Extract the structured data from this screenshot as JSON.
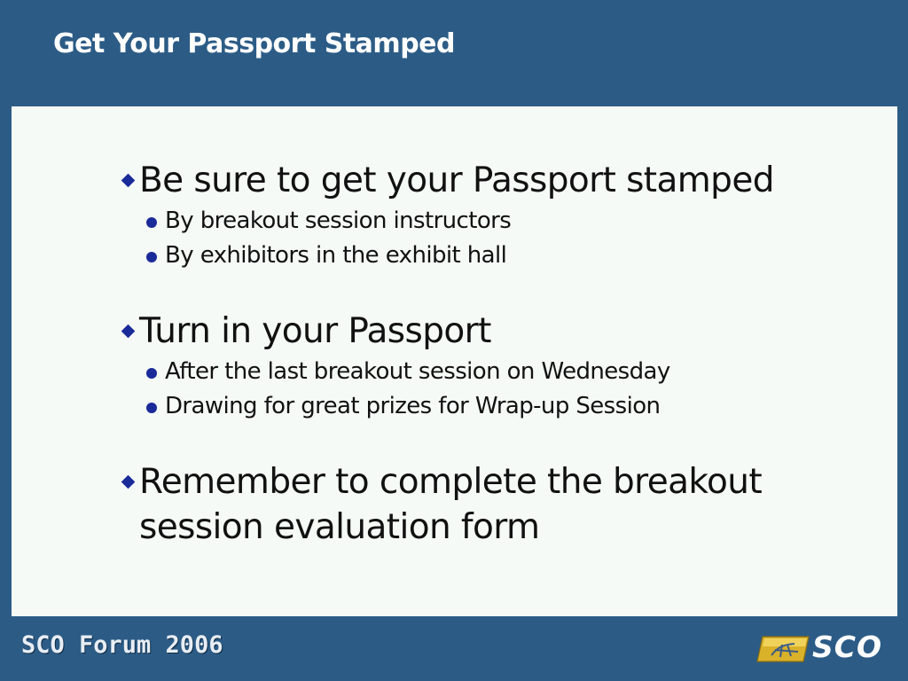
{
  "slide": {
    "title": "Get Your Passport Stamped"
  },
  "bullets": [
    {
      "text": "Be sure to get your Passport stamped",
      "subitems": [
        "By breakout session instructors",
        "By exhibitors in the exhibit hall"
      ]
    },
    {
      "text": "Turn in your Passport",
      "subitems": [
        "After the last breakout session on Wednesday",
        "Drawing for great prizes for Wrap-up Session"
      ]
    },
    {
      "text": "Remember to complete the breakout session evaluation form",
      "subitems": []
    }
  ],
  "footer": {
    "event": "SCO Forum 2006",
    "logo_text": "SCO"
  },
  "icons": {
    "bullet": "diamond-bullet-icon",
    "subbullet": "circle-bullet-icon",
    "logo": "sco-logo-emblem-icon"
  },
  "colors": {
    "frame": "#2c5c86",
    "panel": "#f5faf7",
    "bullet": "#1a2a99",
    "logo_gold": "#d9b22a"
  }
}
